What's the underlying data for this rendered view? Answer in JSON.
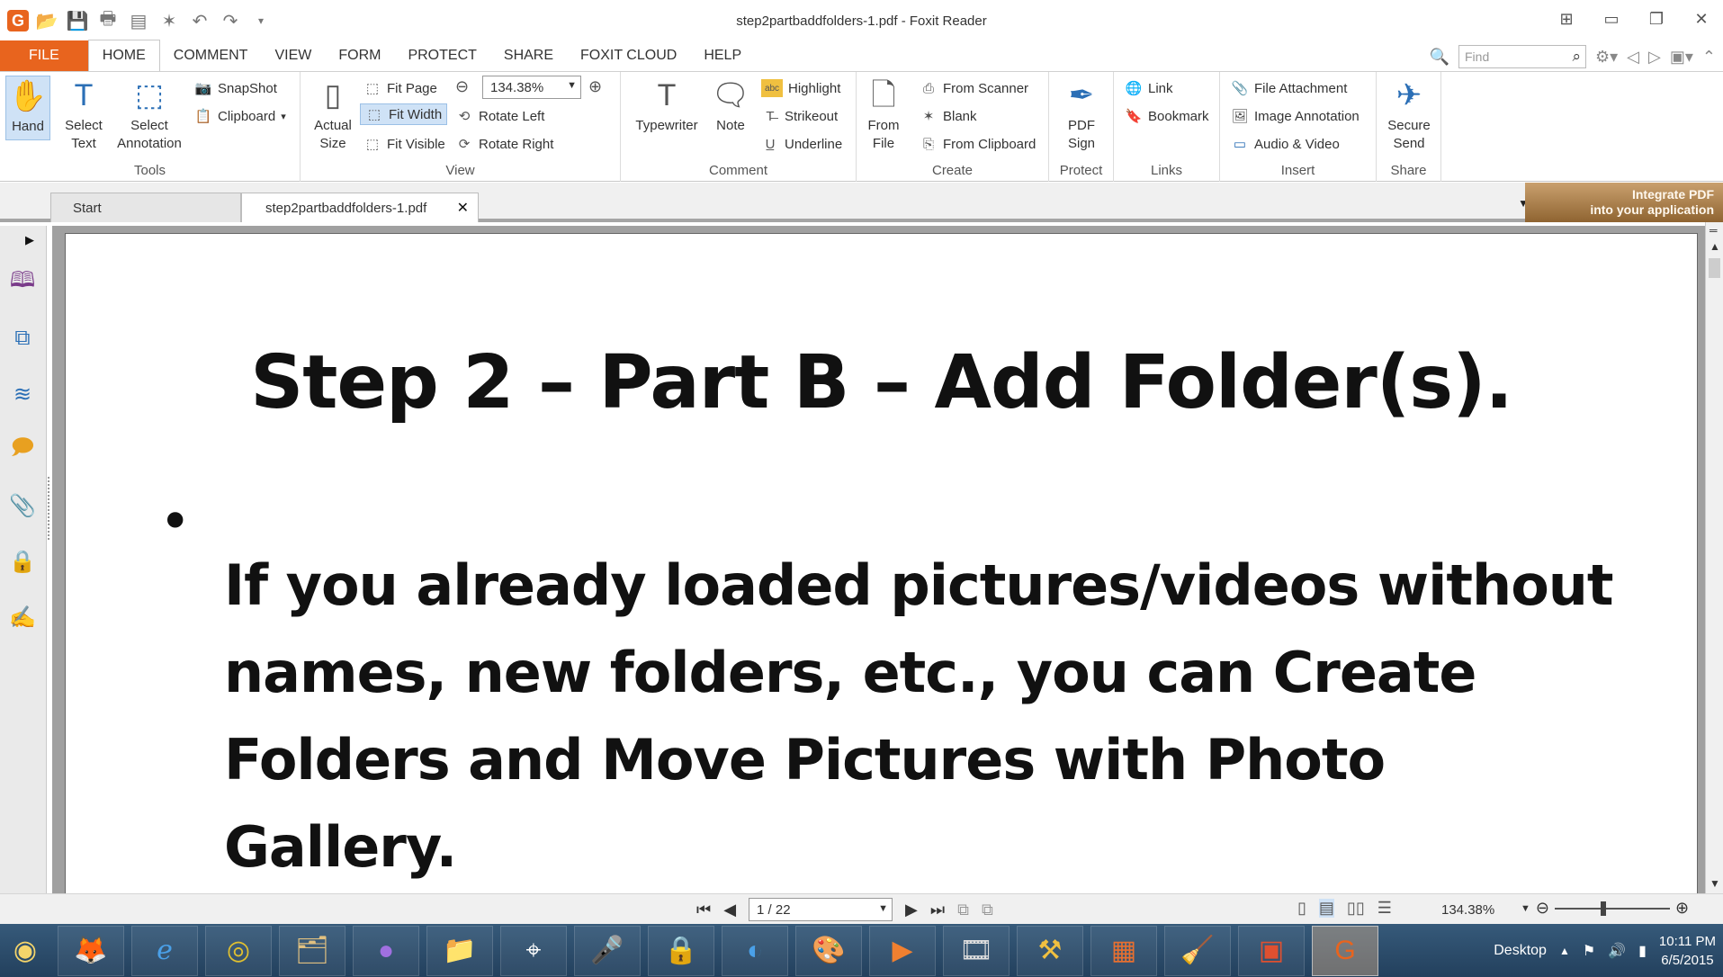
{
  "window": {
    "title": "step2partbaddfolders-1.pdf - Foxit Reader"
  },
  "menu": {
    "tabs": [
      "FILE",
      "HOME",
      "COMMENT",
      "VIEW",
      "FORM",
      "PROTECT",
      "SHARE",
      "FOXIT CLOUD",
      "HELP"
    ],
    "active": "HOME",
    "find_placeholder": "Find"
  },
  "ribbon": {
    "tools": {
      "label": "Tools",
      "hand": "Hand",
      "select_text": "Select Text",
      "select_annotation": "Select Annotation",
      "snapshot": "SnapShot",
      "clipboard": "Clipboard"
    },
    "view": {
      "label": "View",
      "actual_size": "Actual Size",
      "fit_page": "Fit Page",
      "fit_width": "Fit Width",
      "fit_visible": "Fit Visible",
      "zoom_value": "134.38%",
      "rotate_left": "Rotate Left",
      "rotate_right": "Rotate Right"
    },
    "comment": {
      "label": "Comment",
      "typewriter": "Typewriter",
      "note": "Note",
      "highlight": "Highlight",
      "strikeout": "Strikeout",
      "underline": "Underline"
    },
    "create": {
      "label": "Create",
      "from_file": "From File",
      "from_scanner": "From Scanner",
      "blank": "Blank",
      "from_clipboard": "From Clipboard"
    },
    "protect": {
      "label": "Protect",
      "pdf_sign": "PDF Sign"
    },
    "links": {
      "label": "Links",
      "link": "Link",
      "bookmark": "Bookmark"
    },
    "insert": {
      "label": "Insert",
      "file_attachment": "File Attachment",
      "image_annotation": "Image Annotation",
      "audio_video": "Audio & Video"
    },
    "share": {
      "label": "Share",
      "secure_send": "Secure Send"
    }
  },
  "doc_tabs": {
    "start": "Start",
    "current": "step2partbaddfolders-1.pdf",
    "ad_line1": "Integrate PDF",
    "ad_line2": "into your application"
  },
  "document": {
    "heading": "Step 2 – Part B – Add Folder(s).",
    "bullet": "•",
    "lines": [
      "If you already loaded pictures/videos without",
      "names, new folders, etc., you can Create",
      "Folders and Move Pictures with Photo",
      "Gallery."
    ]
  },
  "statusbar": {
    "page": "1 / 22",
    "zoom": "134.38%",
    "zoom_slider_fraction": 0.42
  },
  "taskbar": {
    "desktop_label": "Desktop",
    "time": "10:11 PM",
    "date": "6/5/2015"
  },
  "colors": {
    "accent": "#e8641e",
    "ribbon_icon": "#2b6fb6",
    "selected_bg": "#cfe2f6"
  }
}
